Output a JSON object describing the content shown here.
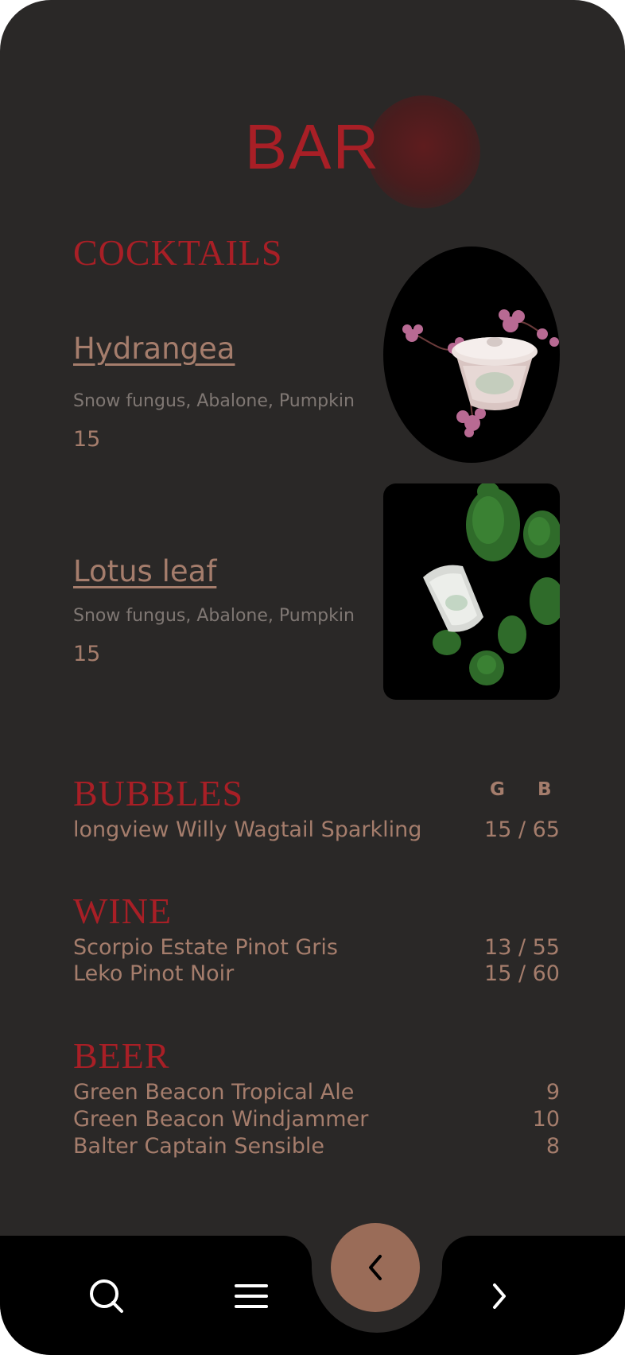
{
  "header": {
    "title": "BAR"
  },
  "cocktails": {
    "title": "COCKTAILS",
    "items": [
      {
        "name": "Hydrangea",
        "ingredients": "Snow fungus, Abalone, Pumpkin",
        "price": "15",
        "image_icon": "hydrangea-drink-photo"
      },
      {
        "name": "Lotus leaf",
        "ingredients": "Snow fungus, Abalone, Pumpkin",
        "price": "15",
        "image_icon": "lotus-leaf-drink-photo"
      }
    ]
  },
  "bubbles": {
    "title": "BUBBLES",
    "col_glass": "G",
    "col_bottle": "B",
    "items": [
      {
        "name": "longview Willy Wagtail Sparkling",
        "price": "15 / 65"
      }
    ]
  },
  "wine": {
    "title": "WINE",
    "items": [
      {
        "name": "Scorpio Estate Pinot Gris",
        "price": "13 / 55"
      },
      {
        "name": "Leko Pinot Noir",
        "price": "15 / 60"
      }
    ]
  },
  "beer": {
    "title": "BEER",
    "items": [
      {
        "name": "Green Beacon Tropical Ale",
        "price": "9"
      },
      {
        "name": "Green Beacon Windjammer",
        "price": "10"
      },
      {
        "name": "Balter Captain Sensible",
        "price": "8"
      }
    ]
  },
  "nav": {
    "icons": [
      "search-icon",
      "menu-icon",
      "chevron-left-icon",
      "chevron-right-icon"
    ]
  },
  "colors": {
    "background": "#2a2827",
    "accent_red": "#a81f26",
    "text_tan": "#a57d6c",
    "text_muted": "#7f7773",
    "nav_bar": "#000000",
    "back_button": "#9a6c58"
  }
}
